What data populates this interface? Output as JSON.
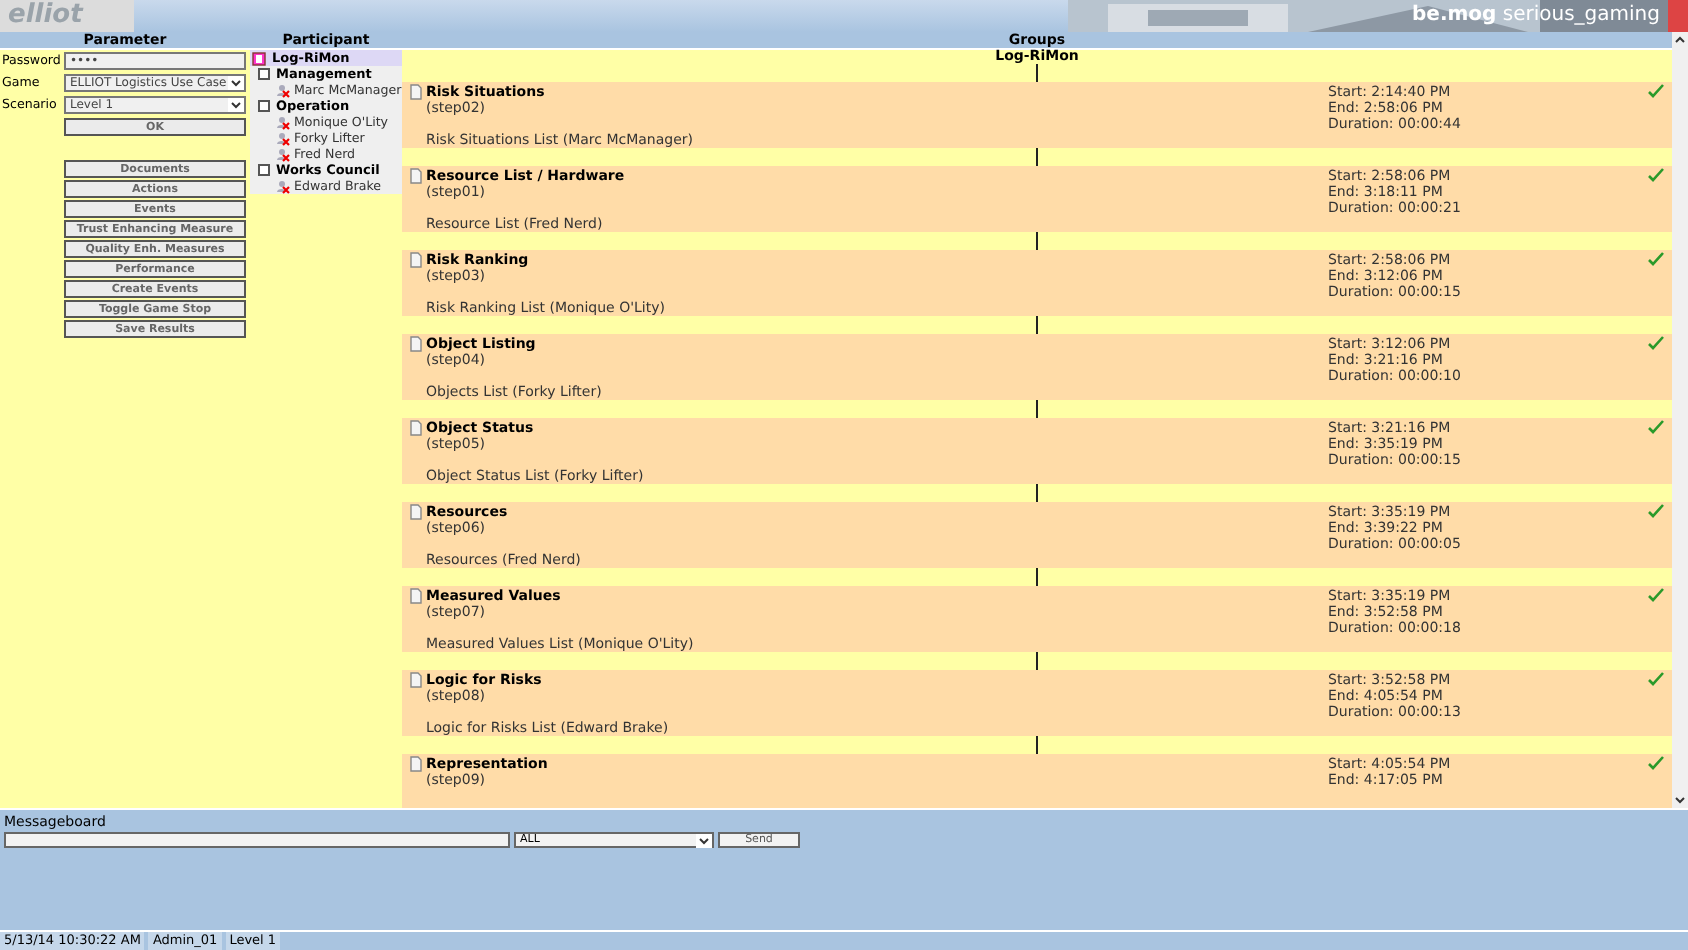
{
  "header": {
    "logo": "elliot",
    "brand_bold": "be.mog",
    "brand": "serious_gaming"
  },
  "parameter": {
    "title": "Parameter",
    "fields": [
      {
        "label": "Password",
        "kind": "password",
        "value": "••••"
      },
      {
        "label": "Game",
        "kind": "select",
        "value": "ELLIOT Logistics Use Case"
      },
      {
        "label": "Scenario",
        "kind": "select",
        "value": "Level 1"
      }
    ],
    "ok": "OK",
    "buttons": [
      "Documents",
      "Actions",
      "Events",
      "Trust Enhancing Measure",
      "Quality Enh. Measures",
      "Performance",
      "Create Events",
      "Toggle Game Stop",
      "Save Results"
    ]
  },
  "participant": {
    "title": "Participant",
    "top": {
      "label": "Log-RiMon",
      "selected": true
    },
    "groups": [
      {
        "label": "Management",
        "checked": false,
        "members": [
          "Marc McManager"
        ]
      },
      {
        "label": "Operation",
        "checked": false,
        "members": [
          "Monique O'Lity",
          "Forky Lifter",
          "Fred Nerd"
        ]
      },
      {
        "label": "Works Council",
        "checked": false,
        "members": [
          "Edward Brake"
        ]
      }
    ]
  },
  "groups": {
    "title": "Groups",
    "subtitle": "Log-RiMon",
    "steps": [
      {
        "title": "Risk Situations",
        "step": "(step02)",
        "list": "Risk Situations List (Marc McManager)",
        "start": "Start: 2:14:40 PM",
        "end": "End: 2:58:06 PM",
        "duration": "Duration: 00:00:44",
        "done": true
      },
      {
        "title": "Resource List / Hardware",
        "step": "(step01)",
        "list": "Resource List (Fred Nerd)",
        "start": "Start: 2:58:06 PM",
        "end": "End: 3:18:11 PM",
        "duration": "Duration: 00:00:21",
        "done": true
      },
      {
        "title": "Risk Ranking",
        "step": "(step03)",
        "list": "Risk Ranking List (Monique O'Lity)",
        "start": "Start: 2:58:06 PM",
        "end": "End: 3:12:06 PM",
        "duration": "Duration: 00:00:15",
        "done": true
      },
      {
        "title": "Object Listing",
        "step": "(step04)",
        "list": "Objects List (Forky Lifter)",
        "start": "Start: 3:12:06 PM",
        "end": "End: 3:21:16 PM",
        "duration": "Duration: 00:00:10",
        "done": true
      },
      {
        "title": "Object Status",
        "step": "(step05)",
        "list": "Object Status List (Forky Lifter)",
        "start": "Start: 3:21:16 PM",
        "end": "End: 3:35:19 PM",
        "duration": "Duration: 00:00:15",
        "done": true
      },
      {
        "title": "Resources",
        "step": "(step06)",
        "list": "Resources (Fred Nerd)",
        "start": "Start: 3:35:19 PM",
        "end": "End: 3:39:22 PM",
        "duration": "Duration: 00:00:05",
        "done": true
      },
      {
        "title": "Measured Values",
        "step": "(step07)",
        "list": "Measured Values List (Monique O'Lity)",
        "start": "Start: 3:35:19 PM",
        "end": "End: 3:52:58 PM",
        "duration": "Duration: 00:00:18",
        "done": true
      },
      {
        "title": "Logic for Risks",
        "step": "(step08)",
        "list": "Logic for Risks List (Edward Brake)",
        "start": "Start: 3:52:58 PM",
        "end": "End: 4:05:54 PM",
        "duration": "Duration: 00:00:13",
        "done": true
      },
      {
        "title": "Representation",
        "step": "(step09)",
        "start": "Start: 4:05:54 PM",
        "end": "End: 4:17:05 PM",
        "done": true
      }
    ]
  },
  "messageboard": {
    "label": "Messageboard",
    "recipient": "ALL",
    "send": "Send"
  },
  "status_bar": [
    "5/13/14 10:30:22 AM",
    "Admin_01",
    "Level 1"
  ]
}
